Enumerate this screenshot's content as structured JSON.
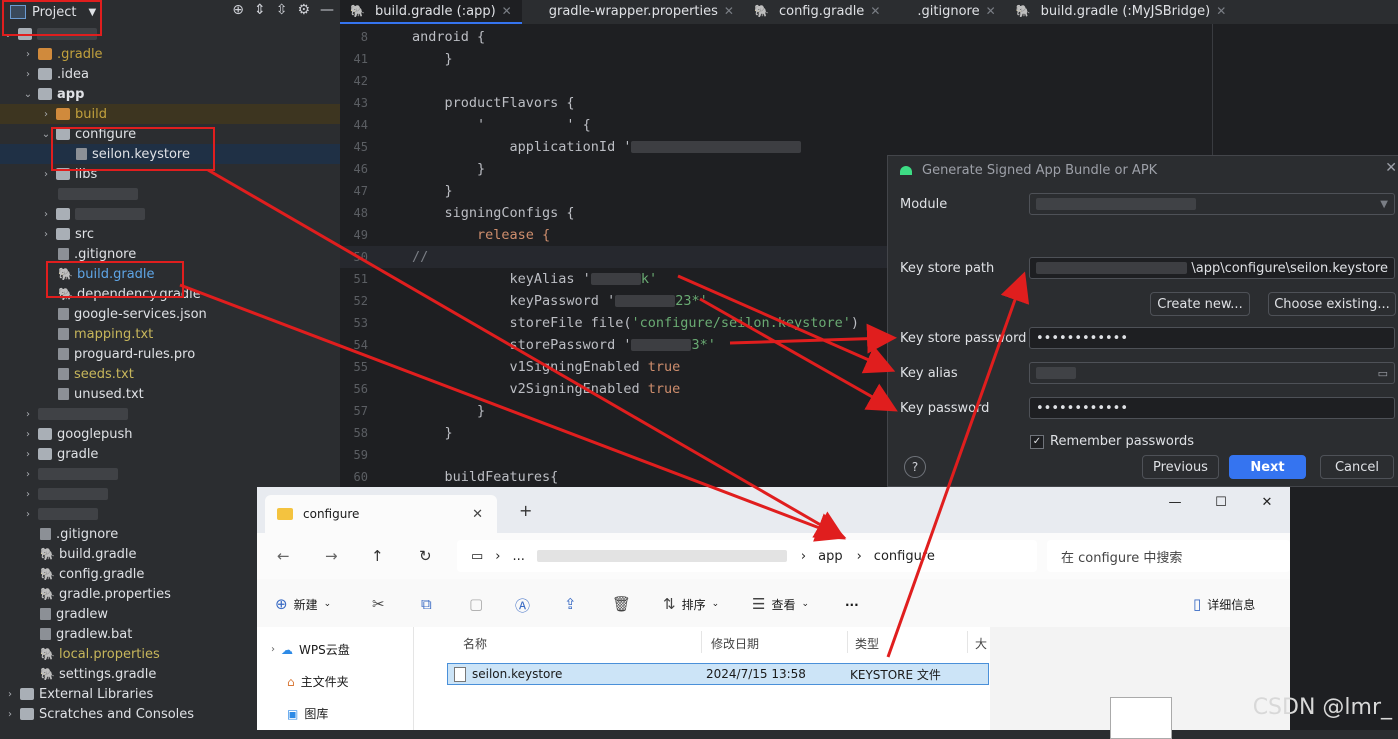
{
  "project_panel": {
    "title": "Project",
    "tree": [
      {
        "label": ".gradle",
        "color": "orange"
      },
      {
        "label": ".idea"
      },
      {
        "label": "app"
      },
      {
        "label": "build",
        "color": "orange"
      },
      {
        "label": "configure"
      },
      {
        "label": "seilon.keystore"
      },
      {
        "label": "libs"
      },
      {
        "label": "src"
      },
      {
        "label": ".gitignore"
      },
      {
        "label": "build.gradle",
        "color": "blue"
      },
      {
        "label": "dependency.gradle"
      },
      {
        "label": "google-services.json"
      },
      {
        "label": "mapping.txt",
        "color": "yellow"
      },
      {
        "label": "proguard-rules.pro"
      },
      {
        "label": "seeds.txt",
        "color": "yellow"
      },
      {
        "label": "unused.txt"
      },
      {
        "label": "googlepush"
      },
      {
        "label": "gradle"
      },
      {
        "label": ".gitignore"
      },
      {
        "label": "build.gradle"
      },
      {
        "label": "config.gradle"
      },
      {
        "label": "gradle.properties"
      },
      {
        "label": "gradlew"
      },
      {
        "label": "gradlew.bat"
      },
      {
        "label": "local.properties",
        "color": "yellow"
      },
      {
        "label": "settings.gradle"
      },
      {
        "label": "External Libraries"
      },
      {
        "label": "Scratches and Consoles"
      }
    ]
  },
  "tabs": [
    {
      "label": "build.gradle (:app)",
      "active": true
    },
    {
      "label": "gradle-wrapper.properties"
    },
    {
      "label": "config.gradle"
    },
    {
      "label": ".gitignore"
    },
    {
      "label": "build.gradle (:MyJSBridge)"
    }
  ],
  "editor": {
    "line_numbers": [
      "8",
      "41",
      "42",
      "43",
      "44",
      "45",
      "46",
      "47",
      "48",
      "49",
      "50",
      "51",
      "52",
      "53",
      "54",
      "55",
      "56",
      "57",
      "58",
      "59",
      "60"
    ],
    "code": {
      "l8": "android {",
      "l41": "    }",
      "l43": "    productFlavors {",
      "l44": "        '          ' {",
      "l45_a": "            applicationId '",
      "l46": "        }",
      "l47": "    }",
      "l48": "    signingConfigs {",
      "l49": "        release {",
      "l50": "//",
      "l51_a": "            keyAlias '",
      "l51_b": "k'",
      "l52_a": "            keyPassword '",
      "l52_b": "23*'",
      "l53_a": "            storeFile file(",
      "l53_b": "'configure/",
      "l53_c": "seilon.keystore'",
      "l53_d": ")",
      "l54_a": "            storePassword '",
      "l54_b": "3*'",
      "l55_a": "            v1SigningEnabled ",
      "l55_b": "true",
      "l56_a": "            v2SigningEnabled ",
      "l56_b": "true",
      "l57": "        }",
      "l58": "    }",
      "l60": "    buildFeatures{"
    }
  },
  "dialog": {
    "title": "Generate Signed App Bundle or APK",
    "module_label": "Module",
    "key_store_path_label": "Key store path",
    "key_store_path_value": "\\app\\configure\\seilon.keystore",
    "create_new": "Create new...",
    "choose_existing": "Choose existing...",
    "key_store_password_label": "Key store password",
    "key_store_password_value": "••••••••••••",
    "key_alias_label": "Key alias",
    "key_password_label": "Key password",
    "key_password_value": "••••••••••••",
    "remember": "Remember passwords",
    "help": "?",
    "previous": "Previous",
    "next": "Next",
    "cancel": "Cancel"
  },
  "explorer": {
    "tab_title": "configure",
    "breadcrumb": [
      "...",
      "app",
      "configure"
    ],
    "search_placeholder": "在 configure 中搜索",
    "commands": {
      "new": "新建",
      "sort": "排序",
      "view": "查看",
      "more": "...",
      "details": "详细信息"
    },
    "nav_items": [
      "WPS云盘",
      "主文件夹",
      "图库"
    ],
    "columns": [
      "名称",
      "修改日期",
      "类型",
      "大"
    ],
    "file": {
      "name": "seilon.keystore",
      "date": "2024/7/15 13:58",
      "type": "KEYSTORE 文件"
    }
  },
  "watermark": "CSDN @lmr_",
  "colors": {
    "annotation_red": "#e01e1e",
    "accent_blue": "#3574f0"
  }
}
